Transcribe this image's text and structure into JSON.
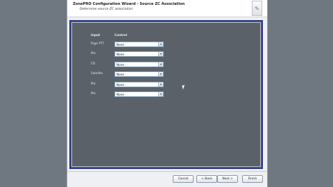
{
  "wizard": {
    "title": "ZonePRO Configuration Wizard - Source ZC Association",
    "subtitle": "Determine source ZC association",
    "header_icon": "wizard-logo-icon"
  },
  "table": {
    "col_input": "Input",
    "col_control": "Control",
    "rows": [
      {
        "label": "Page PTT",
        "value": "None"
      },
      {
        "label": "Mic",
        "value": "None"
      },
      {
        "label": "CD",
        "value": "None"
      },
      {
        "label": "Satellite",
        "value": "None"
      },
      {
        "label": "Mic",
        "value": "None"
      },
      {
        "label": "Mic",
        "value": "None"
      }
    ]
  },
  "buttons": {
    "cancel": "Cancel",
    "back": "< Back",
    "next": "Next >",
    "finish": "Finish"
  },
  "colors": {
    "panel_bg": "#5a6169",
    "panel_border": "#2d3b86",
    "desktop_bg": "#6f7780"
  }
}
